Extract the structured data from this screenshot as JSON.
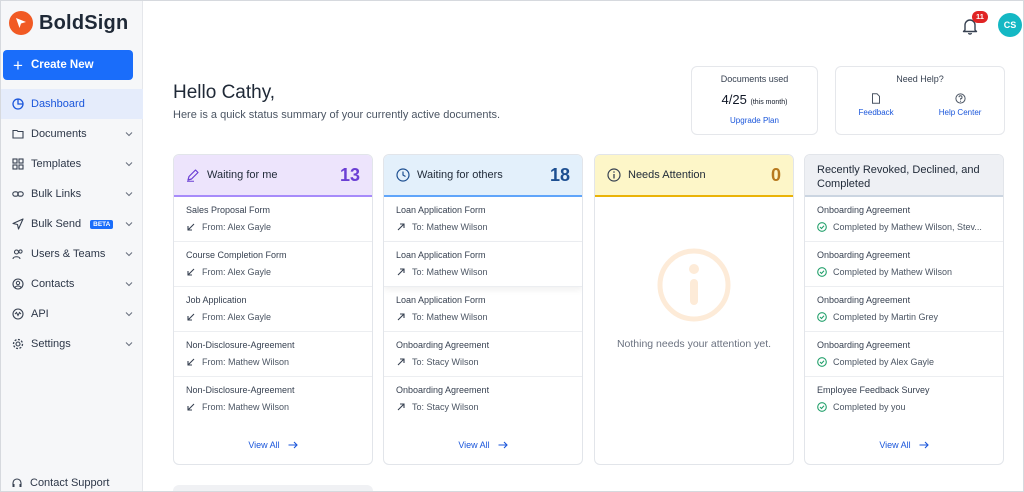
{
  "brand": {
    "name": "BoldSign"
  },
  "sidebar": {
    "create_label": "Create New",
    "items": [
      {
        "label": "Dashboard",
        "icon": "dashboard-icon"
      },
      {
        "label": "Documents",
        "icon": "folder-icon"
      },
      {
        "label": "Templates",
        "icon": "templates-icon"
      },
      {
        "label": "Bulk Links",
        "icon": "link-icon"
      },
      {
        "label": "Bulk Send",
        "icon": "send-icon",
        "badge": "BETA"
      },
      {
        "label": "Users & Teams",
        "icon": "users-icon"
      },
      {
        "label": "Contacts",
        "icon": "contacts-icon"
      },
      {
        "label": "API",
        "icon": "api-icon"
      },
      {
        "label": "Settings",
        "icon": "gear-icon"
      }
    ],
    "support_label": "Contact Support"
  },
  "topbar": {
    "notification_count": "11",
    "avatar_initials": "CS"
  },
  "greeting": {
    "title": "Hello Cathy,",
    "subtitle": "Here is a quick status summary of your currently active documents."
  },
  "docs_used": {
    "title": "Documents used",
    "value": "4/25",
    "period": "(this month)",
    "link": "Upgrade Plan"
  },
  "need_help": {
    "title": "Need Help?",
    "feedback": "Feedback",
    "help_center": "Help Center"
  },
  "columns": {
    "waiting_me": {
      "title": "Waiting for me",
      "count": "13",
      "items": [
        {
          "title": "Sales Proposal Form",
          "sub": "From: Alex Gayle"
        },
        {
          "title": "Course Completion Form",
          "sub": "From: Alex Gayle"
        },
        {
          "title": "Job Application",
          "sub": "From: Alex Gayle"
        },
        {
          "title": "Non-Disclosure-Agreement",
          "sub": "From: Mathew Wilson"
        },
        {
          "title": "Non-Disclosure-Agreement",
          "sub": "From: Mathew Wilson"
        }
      ],
      "view_all": "View All"
    },
    "waiting_others": {
      "title": "Waiting for others",
      "count": "18",
      "items": [
        {
          "title": "Loan Application Form",
          "sub": "To: Mathew Wilson"
        },
        {
          "title": "Loan Application Form",
          "sub": "To: Mathew Wilson"
        },
        {
          "title": "Loan Application Form",
          "sub": "To: Mathew Wilson"
        },
        {
          "title": "Onboarding Agreement",
          "sub": "To: Stacy Wilson"
        },
        {
          "title": "Onboarding Agreement",
          "sub": "To: Stacy Wilson"
        }
      ],
      "view_all": "View All"
    },
    "attention": {
      "title": "Needs Attention",
      "count": "0",
      "empty_text": "Nothing needs your attention yet."
    },
    "completed": {
      "title": "Recently Revoked, Declined, and Completed",
      "items": [
        {
          "title": "Onboarding Agreement",
          "sub": "Completed by Mathew Wilson, Stev..."
        },
        {
          "title": "Onboarding Agreement",
          "sub": "Completed by Mathew Wilson"
        },
        {
          "title": "Onboarding Agreement",
          "sub": "Completed by Martin Grey"
        },
        {
          "title": "Onboarding Agreement",
          "sub": "Completed by Alex Gayle"
        },
        {
          "title": "Employee Feedback Survey",
          "sub": "Completed by you"
        }
      ],
      "view_all": "View All"
    }
  },
  "colors": {
    "brand_orange": "#f15a24",
    "primary": "#1a6dfa",
    "completed_green": "#22a06b"
  }
}
